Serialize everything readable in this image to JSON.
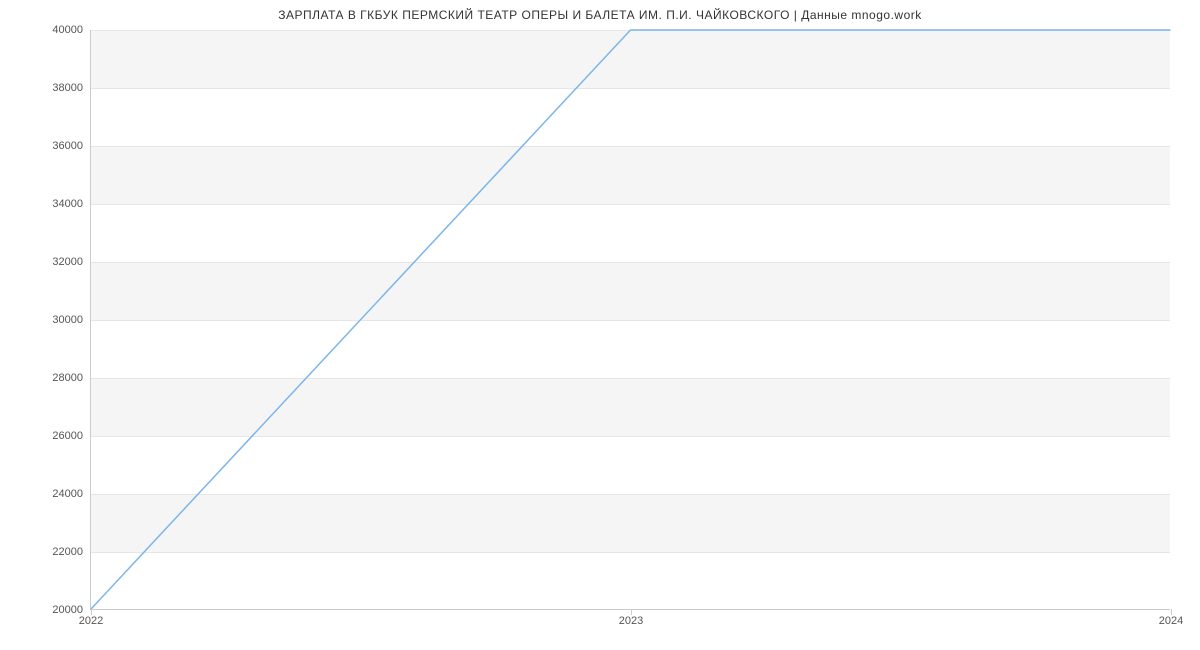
{
  "chart_data": {
    "type": "line",
    "title": "ЗАРПЛАТА В ГКБУК ПЕРМСКИЙ ТЕАТР  ОПЕРЫ И БАЛЕТА ИМ. П.И. ЧАЙКОВСКОГО | Данные mnogo.work",
    "xlabel": "",
    "ylabel": "",
    "x": [
      2022,
      2023,
      2024
    ],
    "values": [
      20000,
      40000,
      40000
    ],
    "x_ticks": [
      2022,
      2023,
      2024
    ],
    "x_tick_labels": [
      "2022",
      "2023",
      "2024"
    ],
    "y_ticks": [
      20000,
      22000,
      24000,
      26000,
      28000,
      30000,
      32000,
      34000,
      36000,
      38000,
      40000
    ],
    "y_tick_labels": [
      "20000",
      "22000",
      "24000",
      "26000",
      "28000",
      "30000",
      "32000",
      "34000",
      "36000",
      "38000",
      "40000"
    ],
    "xlim": [
      2022,
      2024
    ],
    "ylim": [
      20000,
      40000
    ],
    "alternating_bands": true,
    "line_color": "#7cb5ec"
  }
}
